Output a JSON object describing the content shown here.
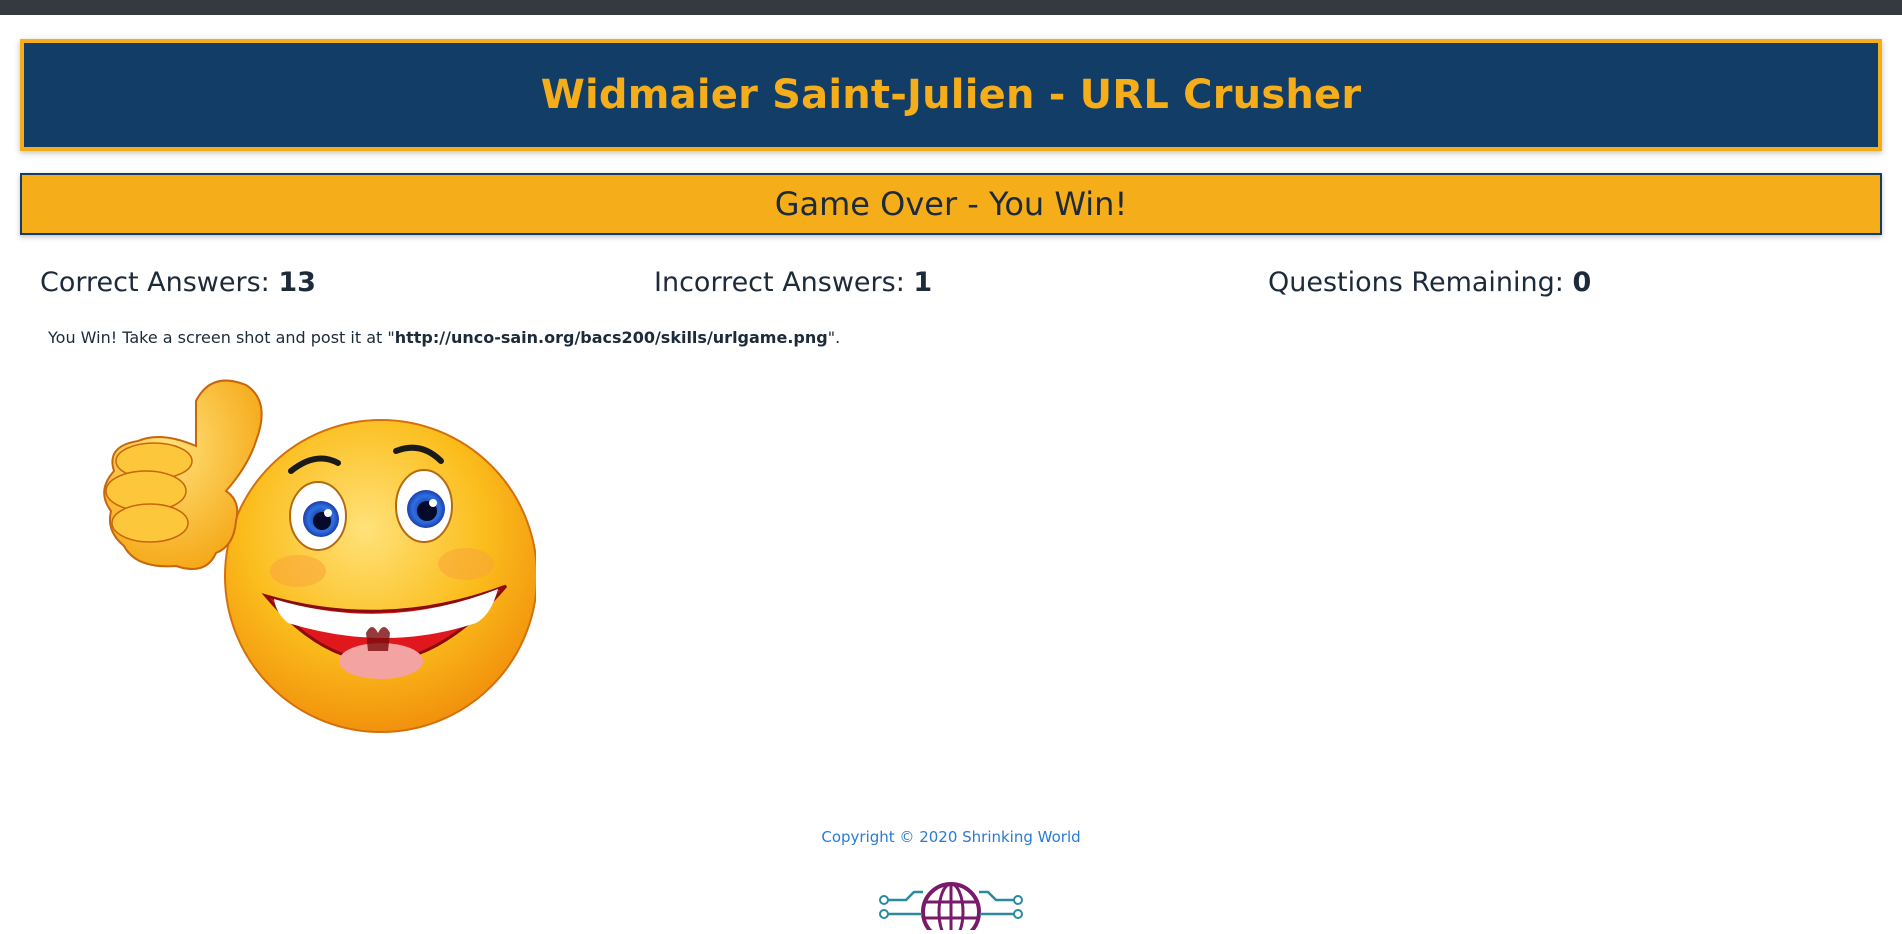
{
  "header": {
    "title": "Widmaier Saint-Julien - URL Crusher"
  },
  "status": {
    "message": "Game Over - You Win!"
  },
  "stats": {
    "correct_label": "Correct Answers:",
    "correct_value": "13",
    "incorrect_label": "Incorrect Answers:",
    "incorrect_value": "1",
    "remaining_label": "Questions Remaining:",
    "remaining_value": "0"
  },
  "result": {
    "text_before": "You Win! Take a screen shot and post it at \"",
    "url": "http://unco-sain.org/bacs200/skills/urlgame.png",
    "text_after": "\"."
  },
  "footer": {
    "copyright": "Copyright © 2020 Shrinking World"
  },
  "colors": {
    "navy": "#123d66",
    "gold": "#f5ae1a",
    "link_blue": "#2a7bd4"
  },
  "icons": {
    "smiley": "thumbs-up-smiley-icon",
    "logo": "globe-circuit-logo-icon"
  }
}
